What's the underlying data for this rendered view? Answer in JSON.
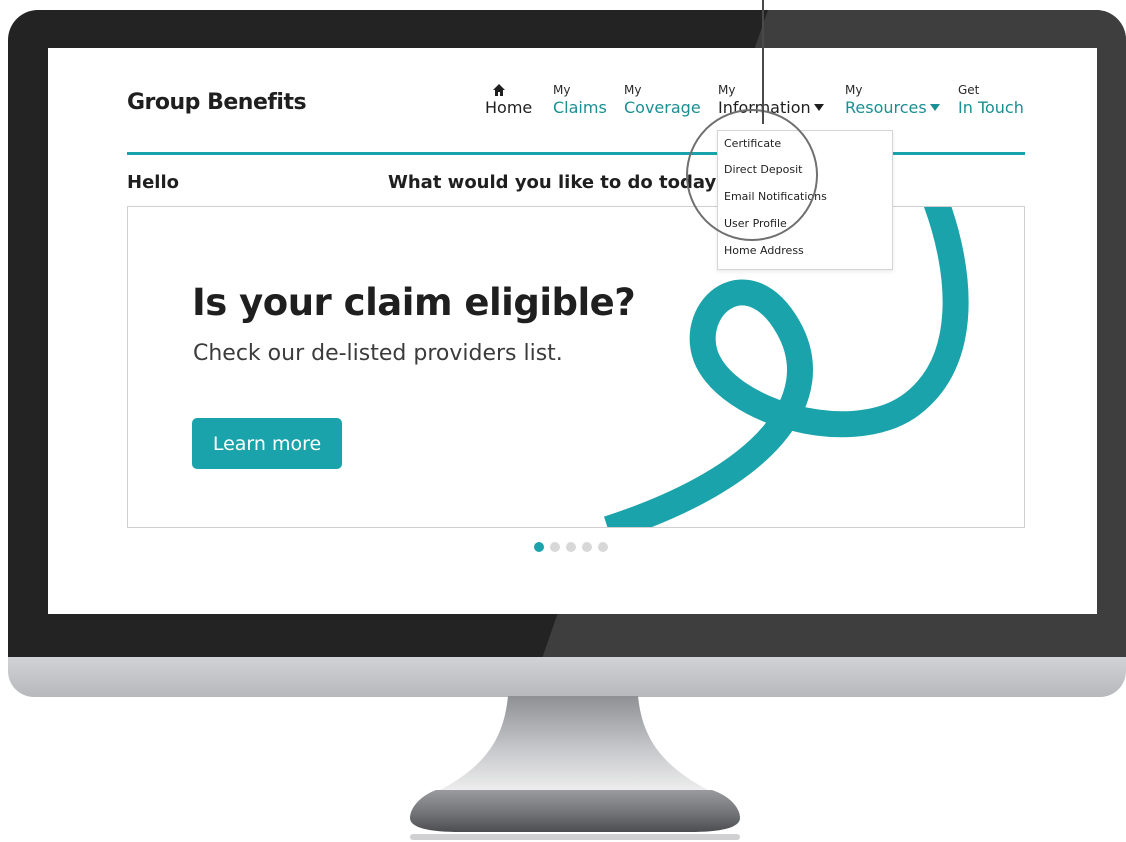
{
  "brand": "Group Benefits",
  "nav": {
    "home": {
      "top": "",
      "label": "Home"
    },
    "claims": {
      "top": "My",
      "label": "Claims"
    },
    "coverage": {
      "top": "My",
      "label": "Coverage"
    },
    "information": {
      "top": "My",
      "label": "Information"
    },
    "resources": {
      "top": "My",
      "label": "Resources"
    },
    "contact": {
      "top": "Get",
      "label": "In Touch"
    }
  },
  "dropdown": {
    "items": [
      "Certificate",
      "Direct Deposit",
      "Email Notifications",
      "User Profile",
      "Home Address"
    ]
  },
  "greeting": "Hello",
  "question": "What would you like to do today?",
  "banner": {
    "headline": "Is your claim eligible?",
    "subline": "Check our de-listed providers list.",
    "button_label": "Learn more"
  },
  "carousel": {
    "slide_count": 5,
    "active_index": 1
  },
  "colors": {
    "accent": "#1aa3aa",
    "text": "#1f1f1f",
    "bezel": "#232323"
  },
  "icons": {
    "home": "home-icon",
    "caret": "caret-down-icon"
  }
}
